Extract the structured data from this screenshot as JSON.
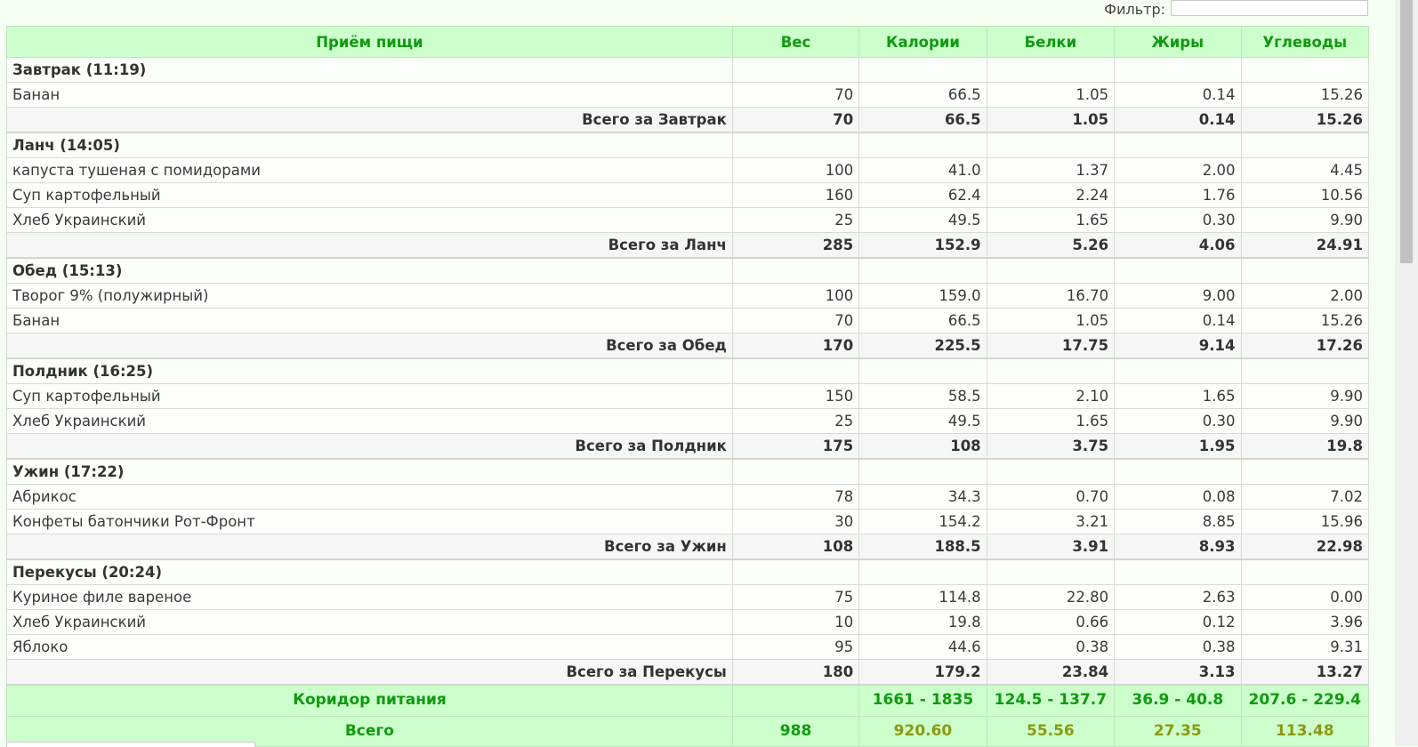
{
  "filter": {
    "label": "Фильтр:",
    "value": ""
  },
  "table": {
    "headers": [
      "Приём пищи",
      "Вес",
      "Калории",
      "Белки",
      "Жиры",
      "Углеводы"
    ],
    "groups": [
      {
        "title": "Завтрак (11:19)",
        "items": [
          {
            "name": "Банан",
            "weight": "70",
            "cal": "66.5",
            "prot": "1.05",
            "fat": "0.14",
            "carb": "15.26"
          }
        ],
        "subtotal": {
          "label": "Всего за Завтрак",
          "weight": "70",
          "cal": "66.5",
          "prot": "1.05",
          "fat": "0.14",
          "carb": "15.26"
        }
      },
      {
        "title": "Ланч (14:05)",
        "items": [
          {
            "name": "капуста тушеная с помидорами",
            "weight": "100",
            "cal": "41.0",
            "prot": "1.37",
            "fat": "2.00",
            "carb": "4.45"
          },
          {
            "name": "Суп картофельный",
            "weight": "160",
            "cal": "62.4",
            "prot": "2.24",
            "fat": "1.76",
            "carb": "10.56"
          },
          {
            "name": "Хлеб Украинский",
            "weight": "25",
            "cal": "49.5",
            "prot": "1.65",
            "fat": "0.30",
            "carb": "9.90"
          }
        ],
        "subtotal": {
          "label": "Всего за Ланч",
          "weight": "285",
          "cal": "152.9",
          "prot": "5.26",
          "fat": "4.06",
          "carb": "24.91"
        }
      },
      {
        "title": "Обед (15:13)",
        "items": [
          {
            "name": "Творог 9% (полужирный)",
            "weight": "100",
            "cal": "159.0",
            "prot": "16.70",
            "fat": "9.00",
            "carb": "2.00"
          },
          {
            "name": "Банан",
            "weight": "70",
            "cal": "66.5",
            "prot": "1.05",
            "fat": "0.14",
            "carb": "15.26"
          }
        ],
        "subtotal": {
          "label": "Всего за Обед",
          "weight": "170",
          "cal": "225.5",
          "prot": "17.75",
          "fat": "9.14",
          "carb": "17.26"
        }
      },
      {
        "title": "Полдник (16:25)",
        "items": [
          {
            "name": "Суп картофельный",
            "weight": "150",
            "cal": "58.5",
            "prot": "2.10",
            "fat": "1.65",
            "carb": "9.90"
          },
          {
            "name": "Хлеб Украинский",
            "weight": "25",
            "cal": "49.5",
            "prot": "1.65",
            "fat": "0.30",
            "carb": "9.90"
          }
        ],
        "subtotal": {
          "label": "Всего за Полдник",
          "weight": "175",
          "cal": "108",
          "prot": "3.75",
          "fat": "1.95",
          "carb": "19.8"
        }
      },
      {
        "title": "Ужин (17:22)",
        "items": [
          {
            "name": "Абрикос",
            "weight": "78",
            "cal": "34.3",
            "prot": "0.70",
            "fat": "0.08",
            "carb": "7.02"
          },
          {
            "name": "Конфеты батончики Рот-Фронт",
            "weight": "30",
            "cal": "154.2",
            "prot": "3.21",
            "fat": "8.85",
            "carb": "15.96"
          }
        ],
        "subtotal": {
          "label": "Всего за Ужин",
          "weight": "108",
          "cal": "188.5",
          "prot": "3.91",
          "fat": "8.93",
          "carb": "22.98"
        }
      },
      {
        "title": "Перекусы (20:24)",
        "items": [
          {
            "name": "Куриное филе вареное",
            "weight": "75",
            "cal": "114.8",
            "prot": "22.80",
            "fat": "2.63",
            "carb": "0.00"
          },
          {
            "name": "Хлеб Украинский",
            "weight": "10",
            "cal": "19.8",
            "prot": "0.66",
            "fat": "0.12",
            "carb": "3.96"
          },
          {
            "name": "Яблоко",
            "weight": "95",
            "cal": "44.6",
            "prot": "0.38",
            "fat": "0.38",
            "carb": "9.31"
          }
        ],
        "subtotal": {
          "label": "Всего за Перекусы",
          "weight": "180",
          "cal": "179.2",
          "prot": "23.84",
          "fat": "3.13",
          "carb": "13.27"
        }
      }
    ],
    "corridor": {
      "label": "Коридор питания",
      "weight": "",
      "cal": "1661 - 1835",
      "prot": "124.5 - 137.7",
      "fat": "36.9 - 40.8",
      "carb": "207.6 - 229.4"
    },
    "total": {
      "label": "Всего",
      "weight": "988",
      "cal": "920.60",
      "prot": "55.56",
      "fat": "27.35",
      "carb": "113.48"
    }
  },
  "colors": {
    "header_bg": "#ccffcc",
    "header_text": "#109a10",
    "total_values": "#8a9a12"
  }
}
